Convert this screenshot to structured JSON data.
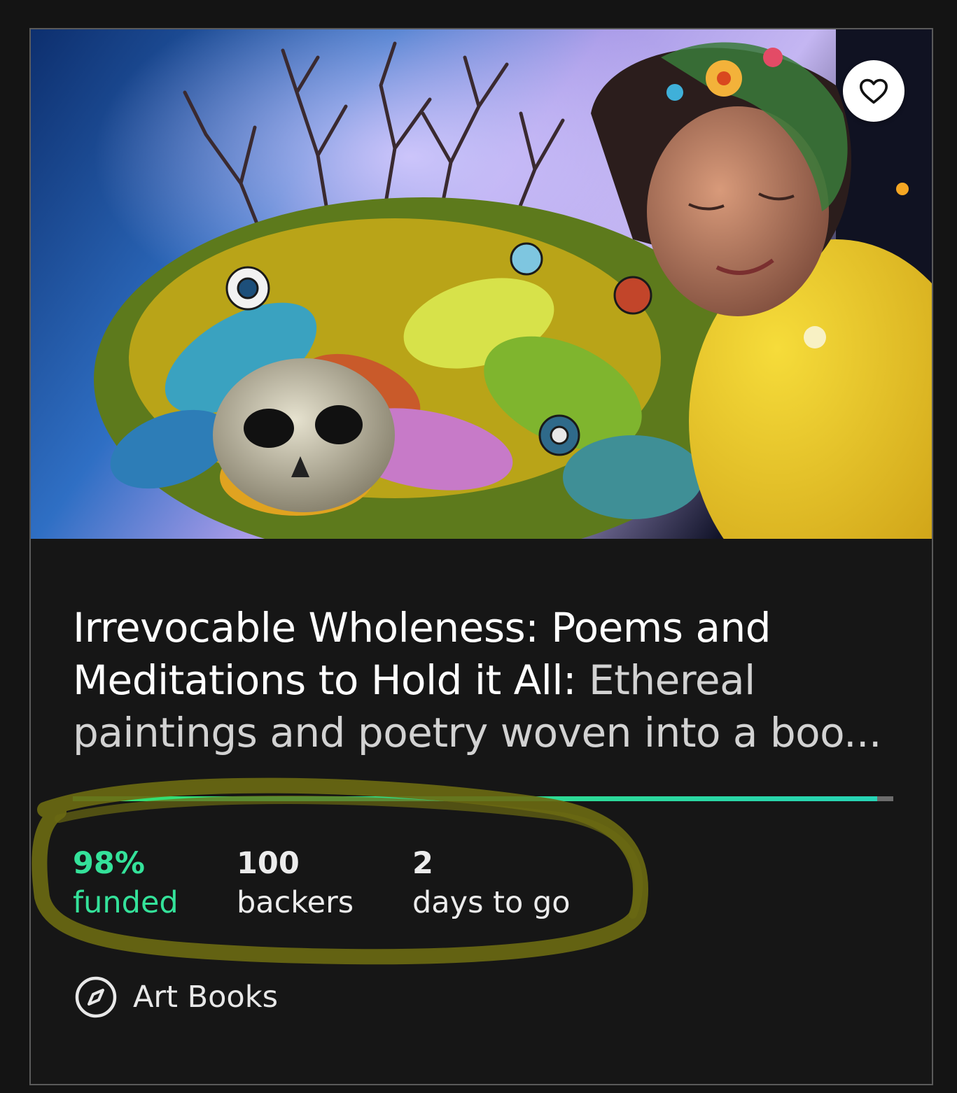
{
  "project": {
    "title_main": "Irrevocable Wholeness: Poems and Meditations to Hold it All:",
    "title_sub": "Ethereal paintings and poetry woven into a boo...",
    "image_alt": "Painting of a woman with eyes closed embracing a skull surrounded by colorful flowers and leaves",
    "favorite_icon": "heart-outline-icon"
  },
  "funding": {
    "progress": 0.98,
    "percent_value": "98%",
    "percent_label": "funded",
    "backers_value": "100",
    "backers_label": "backers",
    "days_value": "2",
    "days_label": "days to go"
  },
  "category": {
    "icon": "compass-icon",
    "label": "Art Books"
  },
  "colors": {
    "background": "#141414",
    "accent_green": "#34e29a",
    "progress_start": "#35e06d",
    "progress_end": "#27d4b6",
    "highlight_marker": "#6b6a12"
  }
}
